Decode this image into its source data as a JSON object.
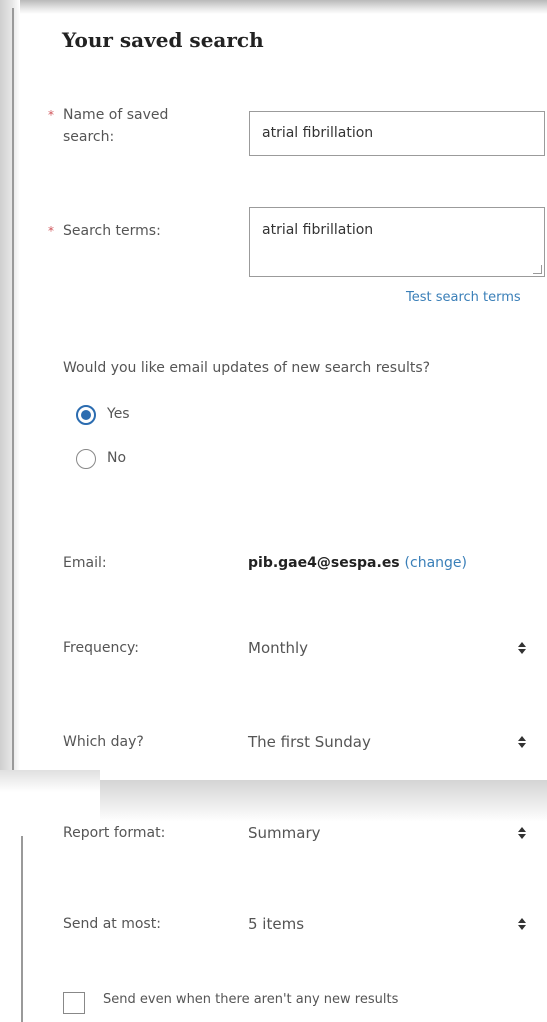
{
  "form": {
    "title": "Your saved search",
    "required_marker": "*",
    "name": {
      "label": "Name of saved search:",
      "label_line1": "Name of saved",
      "label_line2": "search:",
      "value": "atrial fibrillation"
    },
    "terms": {
      "label": "Search terms:",
      "value": "atrial fibrillation",
      "test_link": "Test search terms"
    },
    "email_updates": {
      "question": "Would you like email updates of new search results?",
      "options": [
        {
          "label": "Yes",
          "selected": true
        },
        {
          "label": "No",
          "selected": false
        }
      ]
    },
    "email": {
      "label": "Email:",
      "value": "pib.gae4@sespa.es",
      "change_link": "(change)"
    },
    "frequency": {
      "label": "Frequency:",
      "value": "Monthly"
    },
    "which_day": {
      "label": "Which day?",
      "value": "The first Sunday"
    },
    "report_format": {
      "label": "Report format:",
      "value": "Summary"
    },
    "send_at_most": {
      "label": "Send at most:",
      "value": "5 items"
    },
    "send_even_empty": {
      "label": "Send even when there aren't any new results",
      "checked": false
    }
  },
  "colors": {
    "accent": "#2b6cb0",
    "link": "#3a7fb8",
    "required": "#d0555a"
  },
  "icons": {
    "select_arrows": "sort-updown-icon"
  }
}
